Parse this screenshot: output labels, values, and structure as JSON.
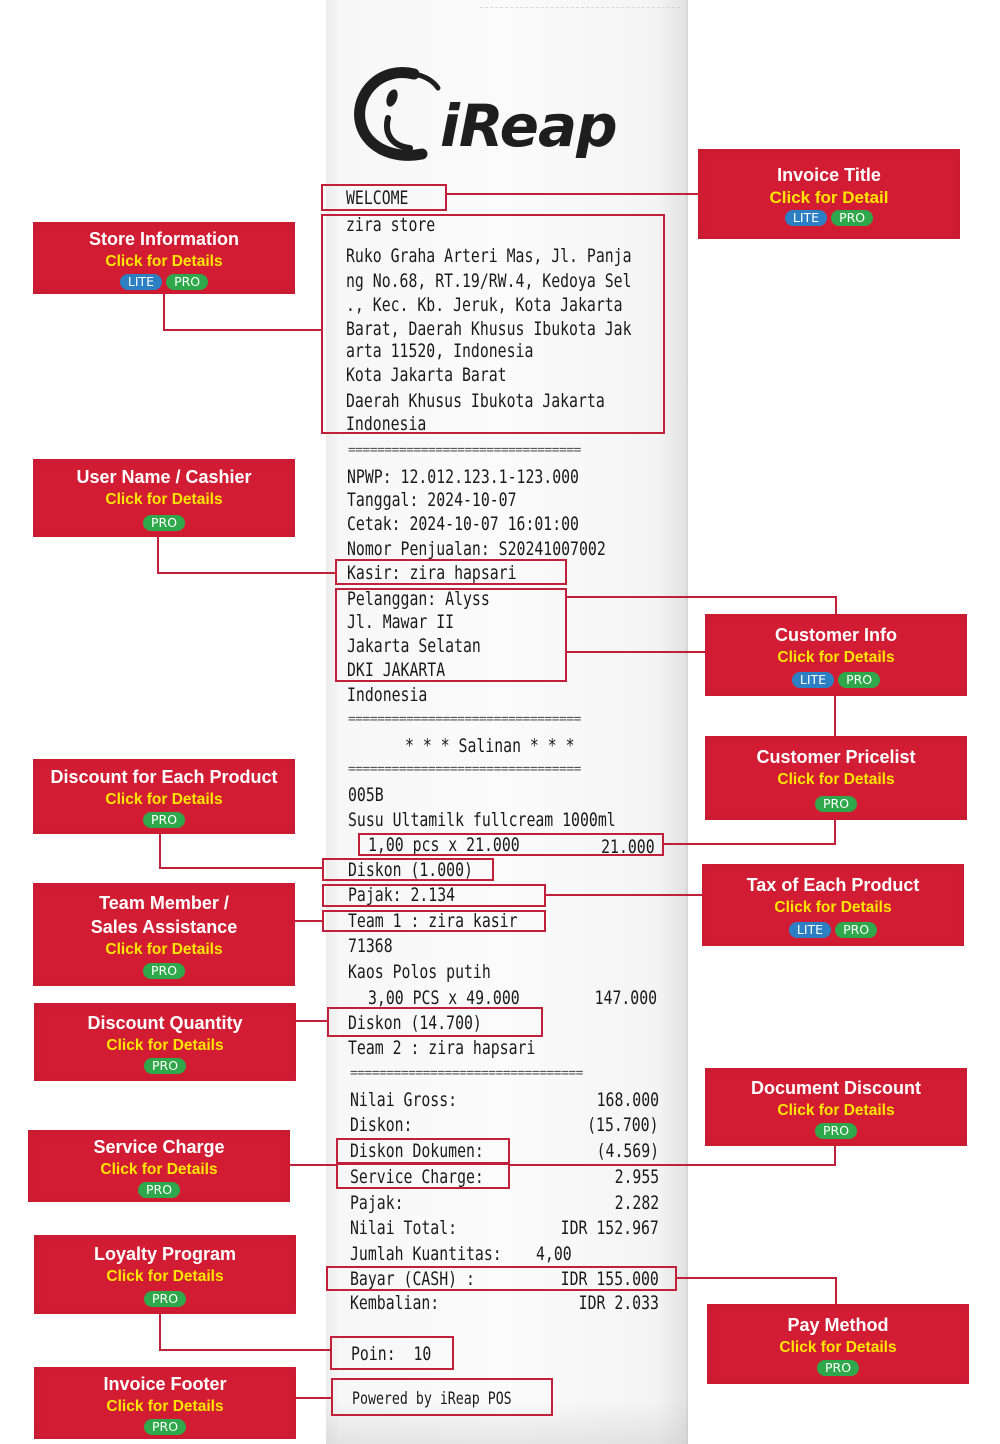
{
  "colors": {
    "accent_red": "#d21c34",
    "link_yellow": "#ffe600",
    "lite_blue": "#2d7fc3",
    "pro_green": "#2ea84a",
    "highlight_border": "#c0203a"
  },
  "logo": {
    "brand": "iReap",
    "icon": "ireap-logo-icon"
  },
  "receipt": {
    "title": "WELCOME",
    "store": [
      "zira store",
      "Ruko Graha Arteri Mas, Jl. Panja",
      "ng No.68, RT.19/RW.4, Kedoya Sel",
      "., Kec. Kb. Jeruk, Kota Jakarta",
      "Barat, Daerah Khusus Ibukota Jak",
      "arta 11520, Indonesia",
      "Kota Jakarta Barat",
      "Daerah Khusus Ibukota Jakarta",
      "Indonesia"
    ],
    "separator": "================================",
    "npwp": "NPWP: 12.012.123.1-123.000",
    "tanggal": "Tanggal: 2024-10-07",
    "cetak": "Cetak: 2024-10-07 16:01:00",
    "nomor": "Nomor Penjualan: S20241007002",
    "kasir": "Kasir: zira hapsari",
    "customer": [
      "Pelanggan: Alyss",
      "Jl. Mawar II",
      "Jakarta Selatan",
      "DKI JAKARTA",
      "Indonesia"
    ],
    "salinan": "* * * Salinan * * *",
    "items": [
      {
        "code": "005B",
        "name": "Susu Ultamilk fullcream 1000ml",
        "qty_line": "1,00 pcs x 21.000",
        "amount": "21.000",
        "discount": "Diskon (1.000)",
        "tax": "Pajak: 2.134",
        "team": "Team 1 : zira kasir"
      },
      {
        "code": "71368",
        "name": "Kaos Polos putih",
        "qty_line": "3,00 PCS x 49.000",
        "amount": "147.000",
        "discount": "Diskon (14.700)",
        "team": "Team 2 : zira hapsari"
      }
    ],
    "totals": [
      {
        "label": "Nilai Gross:",
        "value": "168.000"
      },
      {
        "label": "Diskon:",
        "value": "(15.700)"
      },
      {
        "label": "Diskon Dokumen:",
        "value": "(4.569)"
      },
      {
        "label": "Service Charge:",
        "value": "2.955"
      },
      {
        "label": "Pajak:",
        "value": "2.282"
      },
      {
        "label": "Nilai Total:",
        "value": "IDR 152.967"
      },
      {
        "label": "Jumlah Kuantitas:",
        "value": "4,00"
      },
      {
        "label": "Bayar (CASH) :",
        "value": "IDR 155.000"
      },
      {
        "label": "Kembalian:",
        "value": "IDR 2.033"
      }
    ],
    "poin": "Poin:  10",
    "footer": "Powered by iReap POS"
  },
  "callouts": {
    "invoice_title": {
      "title": "Invoice Title",
      "link": "Click for Detail",
      "badges": [
        "LITE",
        "PRO"
      ]
    },
    "store_info": {
      "title": "Store Information",
      "link": "Click for Details",
      "badges": [
        "LITE",
        "PRO"
      ]
    },
    "cashier": {
      "title": "User Name / Cashier",
      "link": "Click for Details",
      "badges": [
        "PRO"
      ]
    },
    "customer_info": {
      "title": "Customer Info",
      "link": "Click for Details",
      "badges": [
        "LITE",
        "PRO"
      ]
    },
    "customer_pricelist": {
      "title": "Customer Pricelist",
      "link": "Click for Details",
      "badges": [
        "PRO"
      ]
    },
    "discount_each": {
      "title": "Discount for Each Product",
      "link": "Click for Details",
      "badges": [
        "PRO"
      ]
    },
    "tax_each": {
      "title": "Tax of Each Product",
      "link": "Click for Details",
      "badges": [
        "LITE",
        "PRO"
      ]
    },
    "team_member": {
      "title_line1": "Team Member /",
      "title_line2": "Sales Assistance",
      "link": "Click for Details",
      "badges": [
        "PRO"
      ]
    },
    "discount_qty": {
      "title": "Discount Quantity",
      "link": "Click for Details",
      "badges": [
        "PRO"
      ]
    },
    "document_discount": {
      "title": "Document Discount",
      "link": "Click for Details",
      "badges": [
        "PRO"
      ]
    },
    "service_charge": {
      "title": "Service Charge",
      "link": "Click for Details",
      "badges": [
        "PRO"
      ]
    },
    "loyalty": {
      "title": "Loyalty Program",
      "link": "Click for Details",
      "badges": [
        "PRO"
      ]
    },
    "pay_method": {
      "title": "Pay Method",
      "link": "Click for Details",
      "badges": [
        "PRO"
      ]
    },
    "footer": {
      "title": "Invoice Footer",
      "link": "Click for Details",
      "badges": [
        "PRO"
      ]
    }
  }
}
